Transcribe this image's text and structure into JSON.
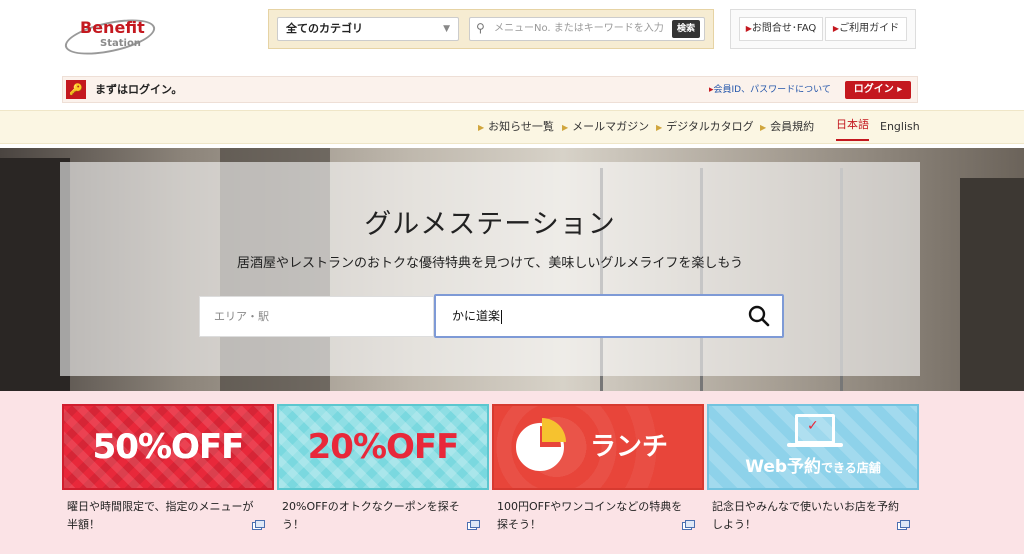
{
  "header": {
    "logo": {
      "line1": "Benefit",
      "line2": "Station"
    },
    "category_select": "全てのカテゴリ",
    "keyword_placeholder": "メニューNo. またはキーワードを入力",
    "search_button": "検索",
    "help_buttons": [
      "お問合せ･FAQ",
      "ご利用ガイド"
    ]
  },
  "login_bar": {
    "message": "まずはログイン。",
    "password_link": "会員ID、パスワードについて",
    "login_button": "ログイン"
  },
  "nav": {
    "items": [
      "お知らせ一覧",
      "メールマガジン",
      "デジタルカタログ",
      "会員規約"
    ],
    "languages": [
      {
        "label": "日本語",
        "active": true
      },
      {
        "label": "English",
        "active": false
      }
    ]
  },
  "hero": {
    "title": "グルメステーション",
    "subtitle": "居酒屋やレストランのおトクな優待特典を見つけて、美味しいグルメライフを楽しもう",
    "area_placeholder": "エリア・駅",
    "keyword_value": "かに道楽"
  },
  "cards": [
    {
      "banner_text": "50%OFF",
      "description": "曜日や時間限定で、指定のメニューが半額！",
      "banner_color": "#e8283a"
    },
    {
      "banner_text": "20%OFF",
      "description": "20%OFFのオトクなクーポンを探そう！",
      "banner_color": "#7ad8df"
    },
    {
      "banner_text": "ランチ",
      "description": "100円OFFやワンコインなどの特典を探そう！",
      "banner_color": "#e8453a"
    },
    {
      "banner_text_main": "Web予約",
      "banner_text_sub": "できる店舗",
      "description": "記念日やみんなで使いたいお店を予約しよう！",
      "banner_color": "#8ed2ea"
    }
  ],
  "colors": {
    "brand_red": "#c4181f",
    "pink_bg": "#fbe3e6",
    "nav_bg": "#fbf6e3"
  }
}
